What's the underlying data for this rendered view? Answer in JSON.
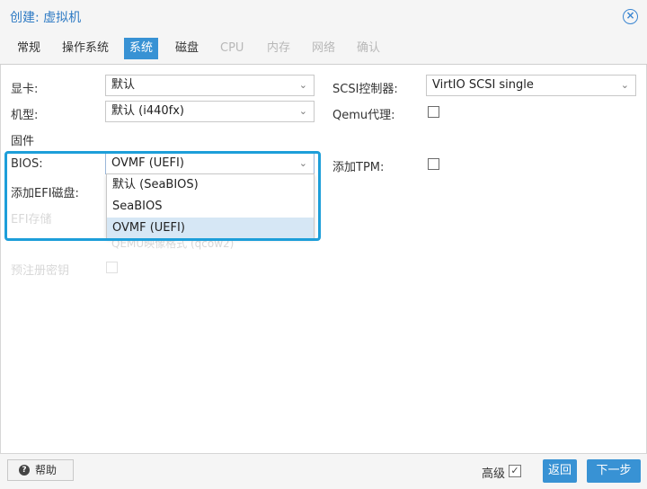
{
  "window": {
    "title": "创建: 虚拟机"
  },
  "tabs": [
    {
      "label": "常规",
      "state": "normal"
    },
    {
      "label": "操作系统",
      "state": "normal"
    },
    {
      "label": "系统",
      "state": "active"
    },
    {
      "label": "磁盘",
      "state": "normal"
    },
    {
      "label": "CPU",
      "state": "disabled"
    },
    {
      "label": "内存",
      "state": "disabled"
    },
    {
      "label": "网络",
      "state": "disabled"
    },
    {
      "label": "确认",
      "state": "disabled"
    }
  ],
  "form": {
    "graphics_label": "显卡:",
    "graphics_value": "默认",
    "machine_label": "机型:",
    "machine_value": "默认 (i440fx)",
    "firmware_heading": "固件",
    "bios_label": "BIOS:",
    "bios_value": "OVMF (UEFI)",
    "add_efi_label": "添加EFI磁盘:",
    "efi_storage_label": "EFI存储",
    "efi_format_hint": "QEMU映像格式 (qcow2)",
    "pre_enroll_label": "预注册密钥",
    "scsi_label": "SCSI控制器:",
    "scsi_value": "VirtIO SCSI single",
    "qemu_agent_label": "Qemu代理:",
    "add_tpm_label": "添加TPM:"
  },
  "bios_options": [
    "默认 (SeaBIOS)",
    "SeaBIOS",
    "OVMF (UEFI)"
  ],
  "footer": {
    "help_label": "帮助",
    "advanced_label": "高级",
    "advanced_checked": true,
    "back_label": "返回",
    "next_label": "下一步"
  },
  "colors": {
    "accent": "#3892d4",
    "highlight": "#1d9ed9",
    "title": "#2f7bc4"
  }
}
